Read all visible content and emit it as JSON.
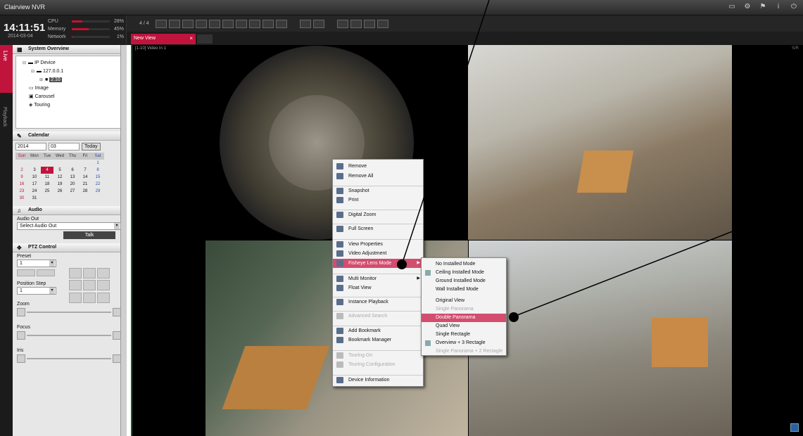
{
  "app": {
    "title": "Clairview NVR"
  },
  "status": {
    "time": "14:11:51",
    "date": "2014-03-04",
    "cpu_label": "CPU",
    "cpu_value": "28%",
    "cpu_level": 0.28,
    "memory_label": "Memory",
    "memory_value": "45%",
    "memory_level": 0.45,
    "network_label": "Network",
    "network_value": "1%",
    "network_level": 0.01
  },
  "toolbar": {
    "page": "4 / 4"
  },
  "tabs": {
    "active": "New View"
  },
  "side_tabs": {
    "live": "Live",
    "playback": "Playback"
  },
  "system_overview": {
    "title": "System Overview",
    "tree": [
      "IP Device",
      "127.0.0.1",
      "2.10",
      "Image",
      "Carousel",
      "Touring"
    ]
  },
  "calendar": {
    "title": "Calendar",
    "year": "2014",
    "month": "03",
    "today_label": "Today",
    "weekdays": [
      "Sun",
      "Mon",
      "Tue",
      "Wed",
      "Thu",
      "Fri",
      "Sat"
    ],
    "days": [
      "",
      "",
      "",
      "",
      "",
      "",
      "1",
      "2",
      "3",
      "4",
      "5",
      "6",
      "7",
      "8",
      "9",
      "10",
      "11",
      "12",
      "13",
      "14",
      "15",
      "16",
      "17",
      "18",
      "19",
      "20",
      "21",
      "22",
      "23",
      "24",
      "25",
      "26",
      "27",
      "28",
      "29",
      "30",
      "31",
      "",
      "",
      "",
      "",
      ""
    ],
    "selected": "4"
  },
  "audio": {
    "title": "Audio",
    "out_label": "Audio Out",
    "select_value": "Select Audio Out",
    "talk_label": "Talk"
  },
  "ptz": {
    "title": "PTZ Control",
    "preset_label": "Preset",
    "preset_value": "1",
    "position_step_label": "Position Step",
    "position_step_value": "1",
    "zoom_label": "Zoom",
    "focus_label": "Focus",
    "iris_label": "Iris"
  },
  "video": {
    "info_left": "[1-10] Video In 1",
    "info_right": "S/R"
  },
  "context_menu": [
    {
      "label": "Remove",
      "disabled": false
    },
    {
      "label": "Remove All",
      "disabled": false
    },
    {
      "label": "Snapshot",
      "disabled": false
    },
    {
      "label": "Print",
      "disabled": false
    },
    {
      "label": "Digital Zoom",
      "disabled": false
    },
    {
      "label": "Full Screen",
      "disabled": false
    },
    {
      "label": "View Properties",
      "disabled": false
    },
    {
      "label": "Video Adjustment",
      "disabled": false
    },
    {
      "label": "Fisheye Lens Mode",
      "disabled": false
    },
    {
      "label": "Multi Monitor",
      "disabled": false
    },
    {
      "label": "Float View",
      "disabled": false
    },
    {
      "label": "Instance Playback",
      "disabled": false
    },
    {
      "label": "Advanced Search",
      "disabled": true
    },
    {
      "label": "Add Bookmark",
      "disabled": false
    },
    {
      "label": "Bookmark Manager",
      "disabled": false
    },
    {
      "label": "Touring On",
      "disabled": true
    },
    {
      "label": "Touring Configuration",
      "disabled": true
    },
    {
      "label": "Device Information",
      "disabled": false
    }
  ],
  "fisheye_submenu": [
    {
      "label": "No Installed Mode",
      "disabled": false
    },
    {
      "label": "Ceiling Installed Mode",
      "disabled": false
    },
    {
      "label": "Ground Installed Mode",
      "disabled": false
    },
    {
      "label": "Wall Installed Mode",
      "disabled": false
    },
    {
      "label": "Original View",
      "disabled": false
    },
    {
      "label": "Single Panorama",
      "disabled": true
    },
    {
      "label": "Double Panorama",
      "disabled": false
    },
    {
      "label": "Quad View",
      "disabled": false
    },
    {
      "label": "Single Rectagle",
      "disabled": false
    },
    {
      "label": "Overview + 3 Rectagle",
      "disabled": false
    },
    {
      "label": "Single Panorama + 2 Rectagle",
      "disabled": true
    }
  ],
  "colors": {
    "accent": "#c0143c",
    "highlight": "#d24d6e",
    "panel": "#e7e7e7"
  }
}
